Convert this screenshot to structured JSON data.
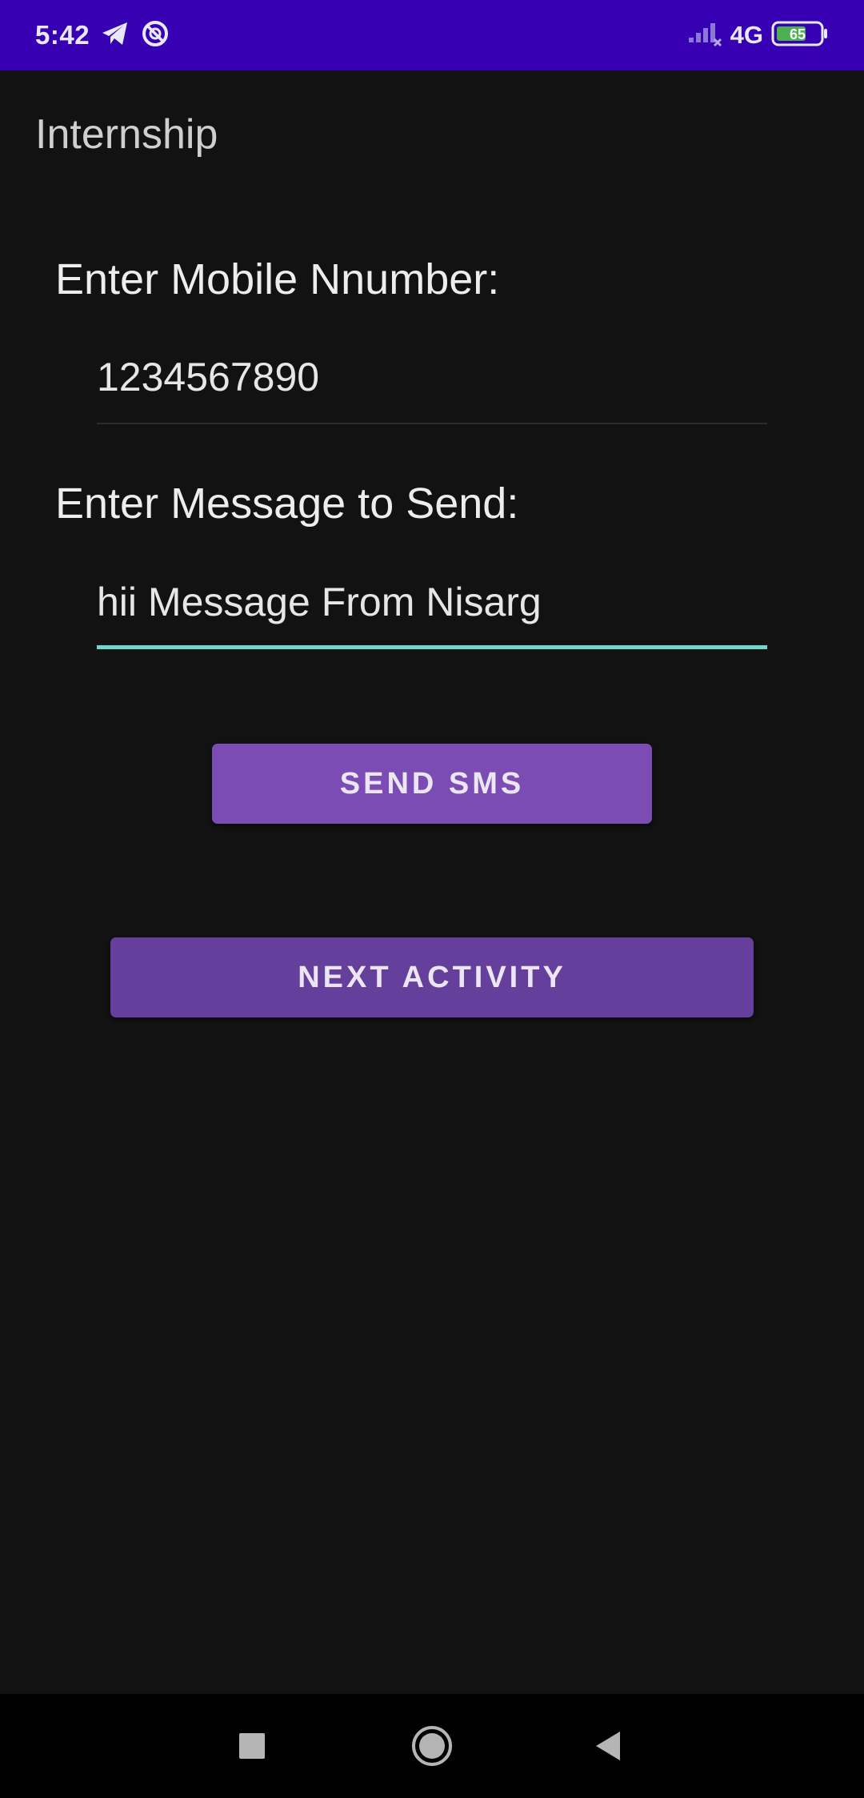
{
  "status_bar": {
    "time": "5:42",
    "network_type": "4G",
    "battery_level": "65",
    "icons": [
      "telegram-icon",
      "sync-icon",
      "signal-icon",
      "network-4g-icon",
      "battery-icon"
    ]
  },
  "app_bar": {
    "title": "Internship"
  },
  "form": {
    "mobile_label": "Enter Mobile Nnumber:",
    "mobile_value": "1234567890",
    "message_label": "Enter Message to Send:",
    "message_value": "hii Message From Nisarg"
  },
  "buttons": {
    "send_sms": "SEND SMS",
    "next_activity": "NEXT ACTIVITY"
  },
  "nav_bar": {
    "icons": [
      "recents-square-icon",
      "home-circle-icon",
      "back-triangle-icon"
    ]
  },
  "colors": {
    "status_bar": "#3700b3",
    "background": "#121212",
    "accent_teal": "#6ed7cc",
    "send_button": "#7b4db4",
    "next_button": "#643f9b"
  }
}
